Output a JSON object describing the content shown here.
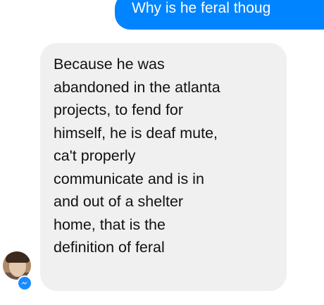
{
  "messages": {
    "outgoing": {
      "text": "Why is he feral thoug"
    },
    "incoming": {
      "lines": [
        "Because he was",
        "abandoned in the atlanta",
        "projects, to fend for",
        "himself, he is deaf mute,",
        "ca't properly",
        "communicate and is in",
        "and out of a shelter",
        "home, that is the",
        "definition of feral"
      ]
    }
  },
  "icons": {
    "avatar": "profile-avatar",
    "badge": "messenger-icon"
  },
  "colors": {
    "outgoing_bubble": "#0084ff",
    "incoming_bubble": "#f1f0f0",
    "outgoing_text": "#ffffff",
    "incoming_text": "#111111"
  }
}
